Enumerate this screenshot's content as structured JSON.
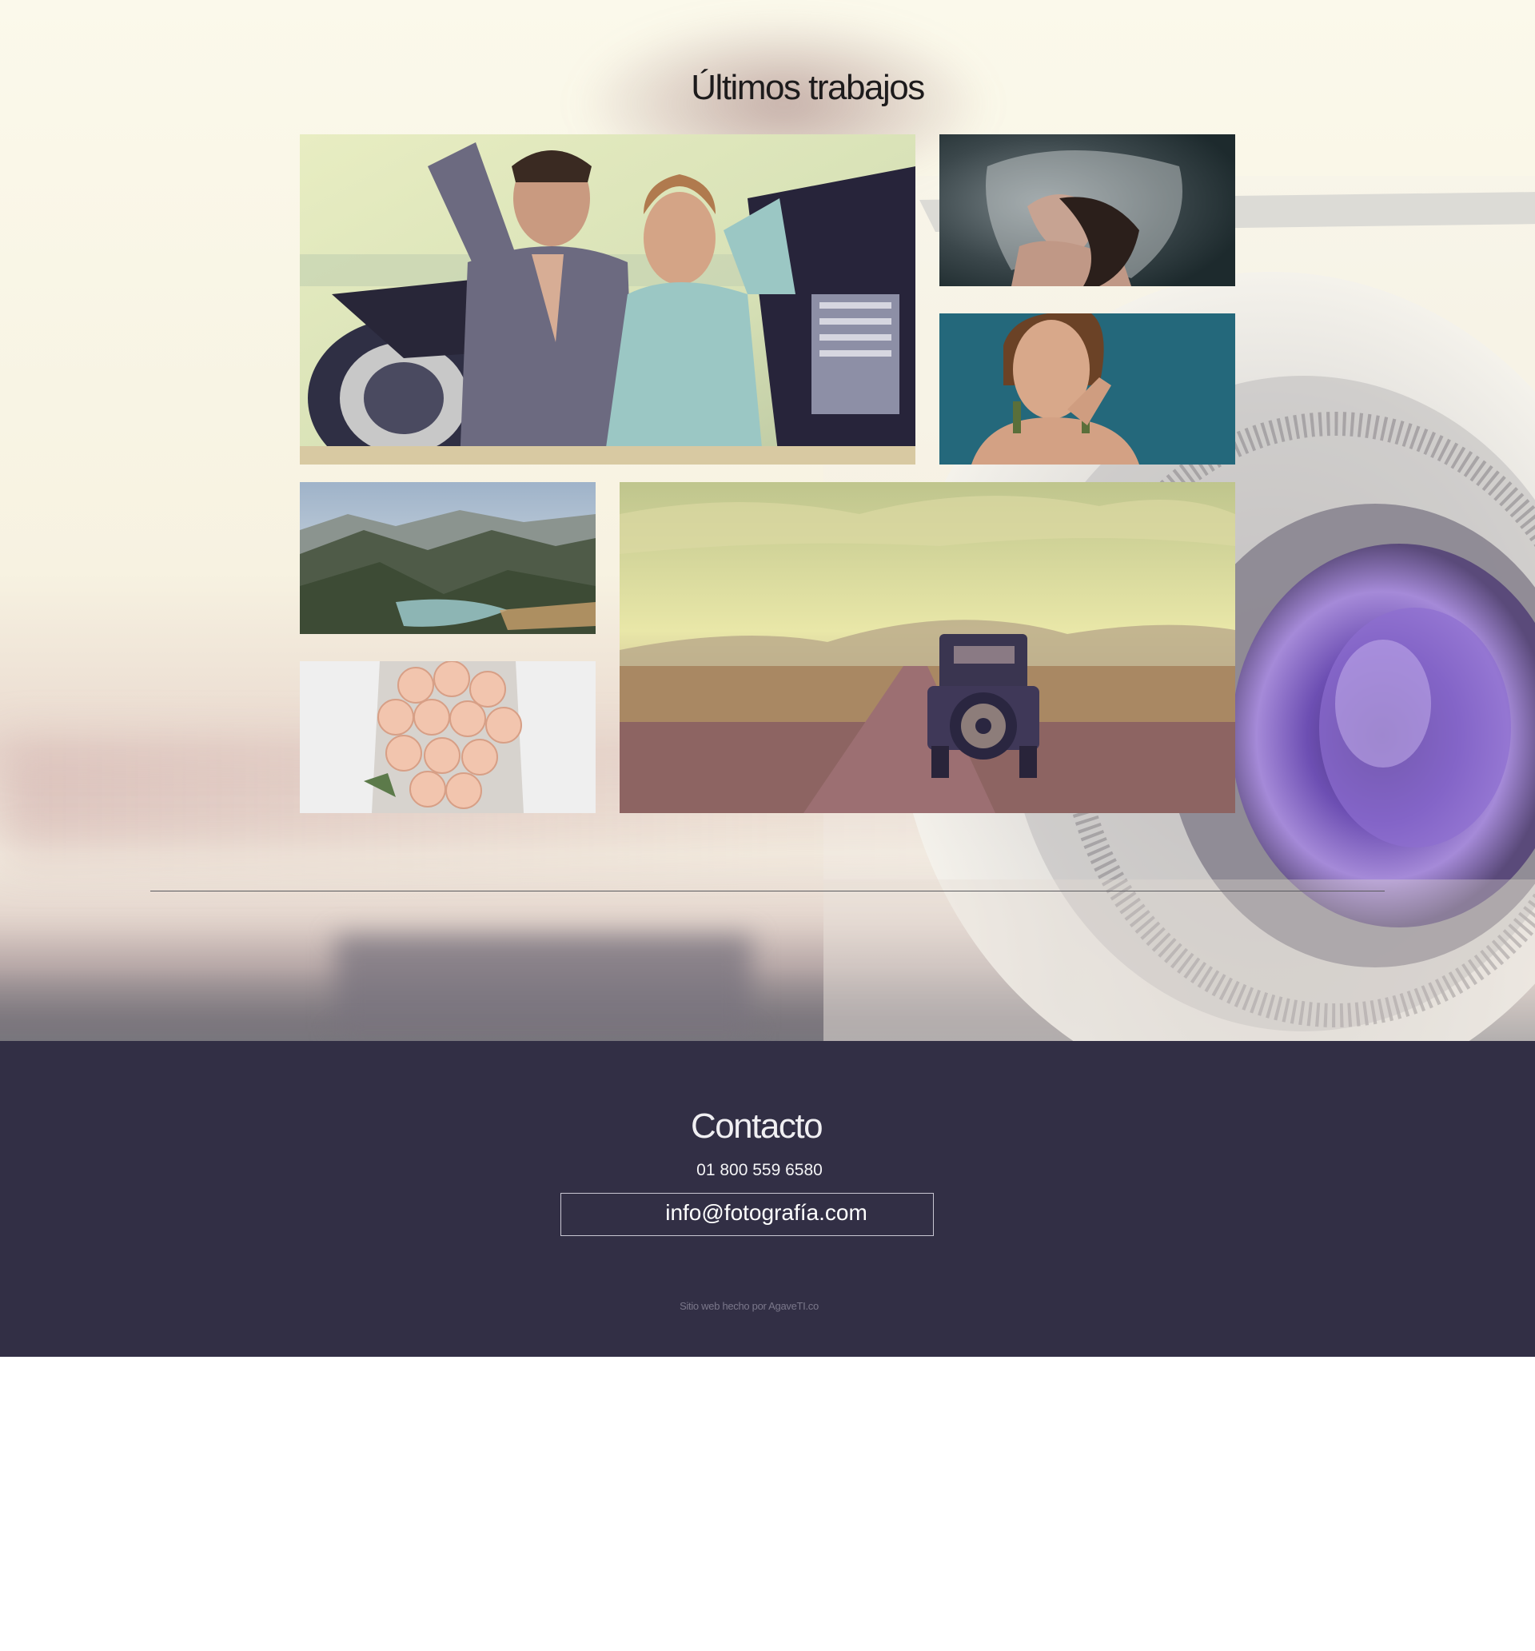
{
  "gallery": {
    "title": "Últimos trabajos",
    "photos": [
      {
        "name": "moto-couple-photo"
      },
      {
        "name": "veil-woman-photo"
      },
      {
        "name": "portrait-woman-photo"
      },
      {
        "name": "mountain-landscape-photo"
      },
      {
        "name": "roses-bouquet-photo"
      },
      {
        "name": "vintage-car-road-photo"
      }
    ]
  },
  "contact": {
    "title": "Contacto",
    "phone": "01 800 559 6580",
    "email": "info@fotografía.com",
    "credit": "Sitio web hecho por AgaveTI.co"
  },
  "colors": {
    "footer_bg": "#322f45",
    "hero_bg": "#fbf9eb",
    "title_text": "#1d1b1c"
  }
}
